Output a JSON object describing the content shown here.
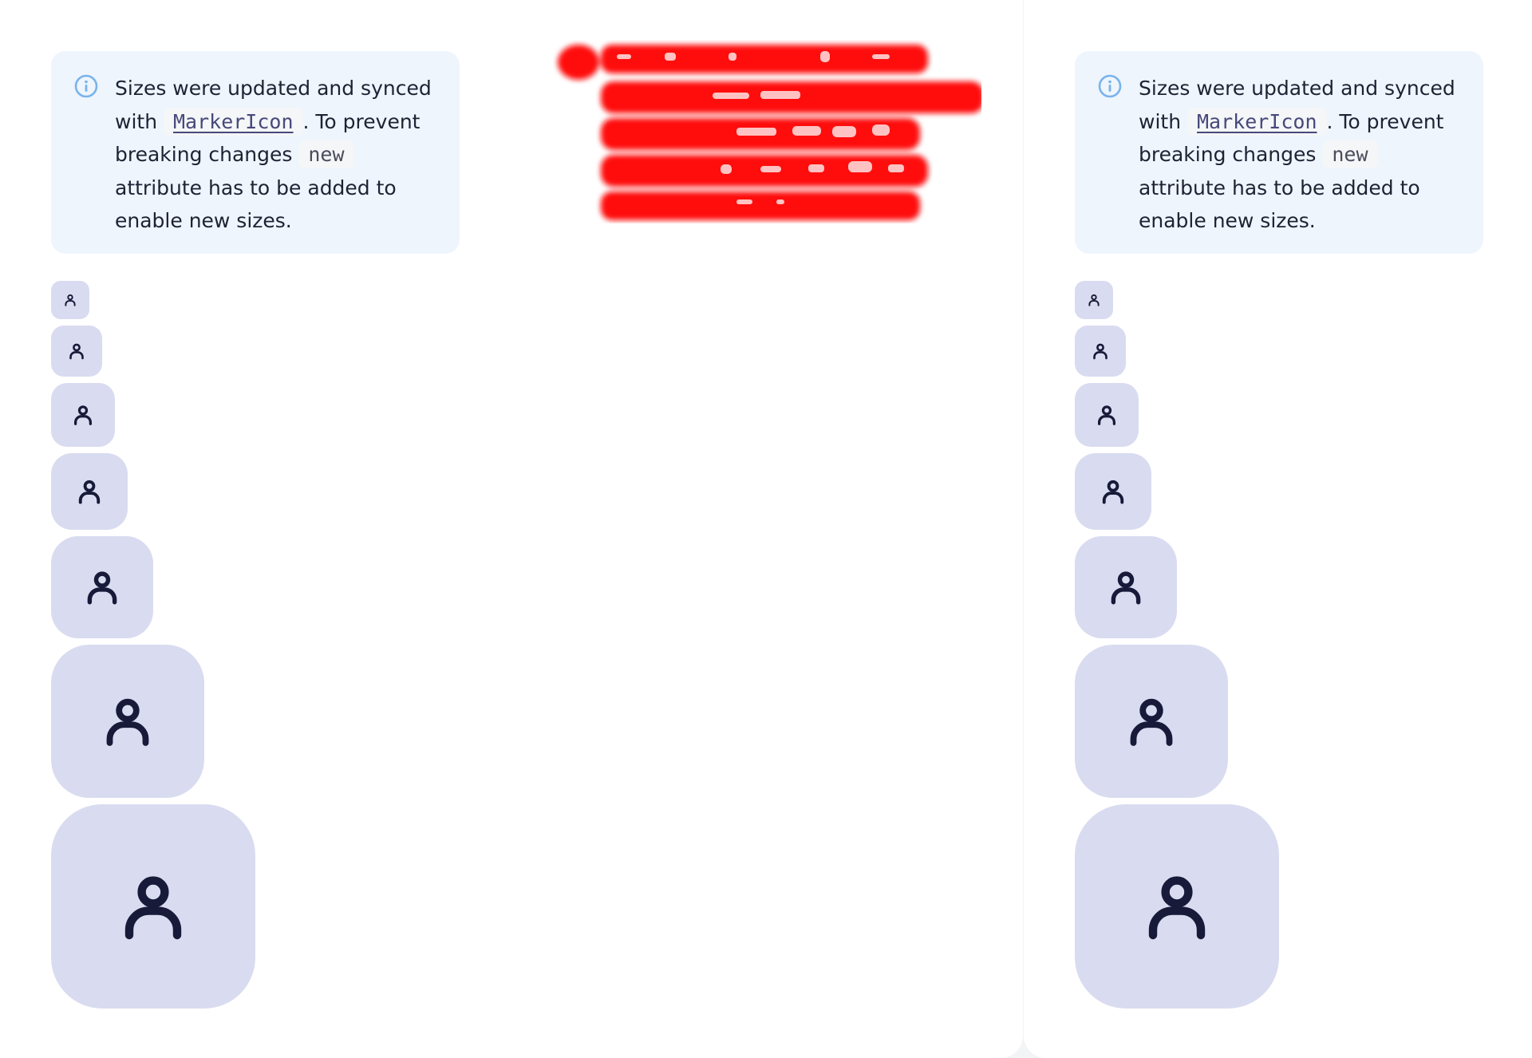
{
  "callout": {
    "text_before": "Sizes were updated and synced with",
    "link_code": "MarkerIcon",
    "text_middle": ". To prevent breaking changes",
    "code": "new",
    "text_after": "attribute has to be added to enable new sizes."
  },
  "markers": {
    "icon": "user-icon",
    "count_per_panel": 7,
    "background": "#d9dcf0",
    "foreground": "#171a38"
  },
  "colors": {
    "info_accent": "#7ab3ea",
    "callout_bg": "#eef5fd",
    "redaction": "#ff0000"
  }
}
